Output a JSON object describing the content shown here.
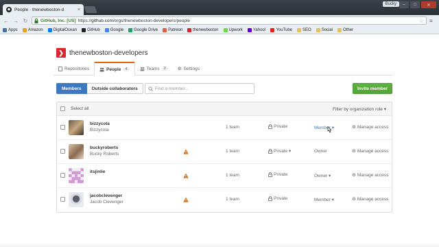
{
  "browser": {
    "tab_title": "People · thenewboston-d",
    "user_label": "Bucky",
    "ev_label": "GitHub, Inc. [US]",
    "url_scheme": "https://",
    "url_host": "github.com",
    "url_path": "/orgs/thenewboston-developers/people",
    "bookmarks": [
      {
        "label": "Apps",
        "color": "#4a6fa5"
      },
      {
        "label": "Amazon",
        "color": "#f0a020"
      },
      {
        "label": "DigitalOcean",
        "color": "#0080ff"
      },
      {
        "label": "GitHub",
        "color": "#222222"
      },
      {
        "label": "Google",
        "color": "#4285f4"
      },
      {
        "label": "Google Drive",
        "color": "#1fa463"
      },
      {
        "label": "Patreon",
        "color": "#e85b46"
      },
      {
        "label": "thenewboston",
        "color": "#d7282f"
      },
      {
        "label": "Upwork",
        "color": "#6fda44"
      },
      {
        "label": "Yahoo!",
        "color": "#6001d2"
      },
      {
        "label": "YouTube",
        "color": "#e62117"
      },
      {
        "label": "SEO",
        "color": "#e8c15a"
      },
      {
        "label": "Social",
        "color": "#e8c15a"
      },
      {
        "label": "Other",
        "color": "#e8c15a"
      }
    ]
  },
  "org": {
    "name": "thenewboston-developers",
    "logo_glyph": "❯",
    "brand_color": "#d7282f"
  },
  "tabs": [
    {
      "label": "Repositories",
      "count": "",
      "icon": "repo-icon"
    },
    {
      "label": "People",
      "count": "4",
      "icon": "people-icon"
    },
    {
      "label": "Teams",
      "count": "3",
      "icon": "teams-icon"
    },
    {
      "label": "Settings",
      "count": "",
      "icon": "gear-icon"
    }
  ],
  "subnav": {
    "members_label": "Members",
    "outside_label": "Outside collaborators"
  },
  "search": {
    "placeholder": "Find a member..."
  },
  "invite_label": "Invite member",
  "table": {
    "select_all": "Select all",
    "filter_label": "Filter by organization role ▾",
    "rows": [
      {
        "login": "bizzycola",
        "full_name": "Bizzycola",
        "warning": false,
        "teams": "1 team",
        "visibility": "Private",
        "visibility_dropdown": false,
        "role": "Member ▾",
        "role_link": true,
        "manage": "Manage access"
      },
      {
        "login": "buckyroberts",
        "full_name": "Bucky Roberts",
        "warning": true,
        "teams": "1 team",
        "visibility": "Private ▾",
        "visibility_dropdown": true,
        "role": "Owner",
        "role_link": false,
        "manage": "Manage access"
      },
      {
        "login": "itsjinlie",
        "full_name": "",
        "warning": true,
        "teams": "1 team",
        "visibility": "Private",
        "visibility_dropdown": false,
        "role": "Owner ▾",
        "role_link": false,
        "manage": "Manage access"
      },
      {
        "login": "jacobclevenger",
        "full_name": "Jacob Clevenger",
        "warning": true,
        "teams": "1 team",
        "visibility": "Private",
        "visibility_dropdown": false,
        "role": "Member ▾",
        "role_link": false,
        "manage": "Manage access"
      }
    ]
  },
  "colors": {
    "accent_blue": "#4078c0",
    "invite_green": "#55a532",
    "warning_orange": "#d26911"
  }
}
